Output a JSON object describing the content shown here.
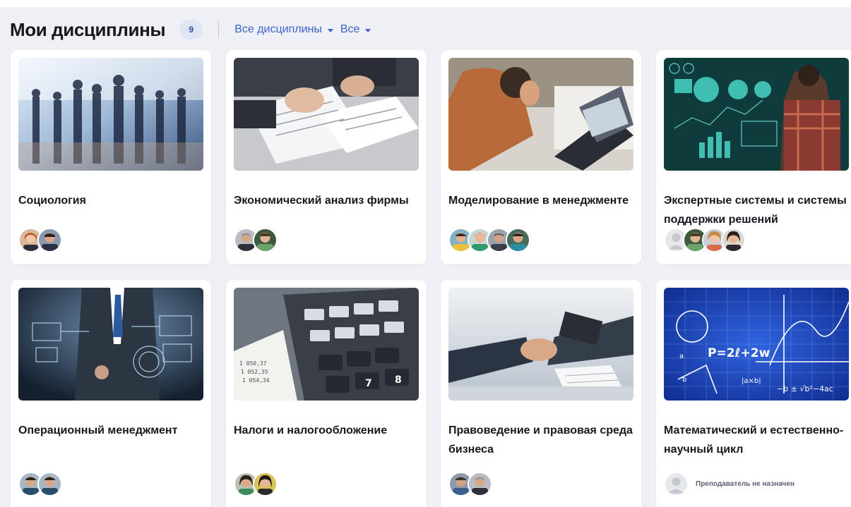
{
  "header": {
    "title": "Мои дисциплины",
    "count": "9",
    "filter_disciplines": "Все дисциплины",
    "filter_status": "Все"
  },
  "colors": {
    "accent": "#3c63c9",
    "badge_bg": "#dfe5f3",
    "page_bg": "#eef0f5"
  },
  "cards": [
    {
      "title": "Социология",
      "image": "business-people-crowd",
      "avatars": [
        "woman-red-hair",
        "man-dark-suit"
      ]
    },
    {
      "title": "Экономический анализ фирмы",
      "image": "signing-documents",
      "avatars": [
        "man-glasses-gray",
        "man-green-shirt"
      ]
    },
    {
      "title": "Моделирование в менеджменте",
      "image": "man-at-laptop",
      "avatars": [
        "man-yellow-shirt",
        "woman-green",
        "man-gray-suit",
        "man-teal-shirt"
      ]
    },
    {
      "title": "Экспертные системы и системы поддержки решений",
      "image": "data-charts-screen",
      "avatars": [
        "placeholder",
        "man-green-shirt",
        "woman-blonde",
        "woman-dark"
      ]
    },
    {
      "title": "Операционный менеджмент",
      "image": "virtual-interface",
      "avatars": [
        "man-young",
        "man-young-2"
      ]
    },
    {
      "title": "Налоги и налогообложение",
      "image": "calculator-keys",
      "avatars": [
        "woman-green-top",
        "woman-dark-hair"
      ]
    },
    {
      "title": "Правоведение и правовая среда бизнеса",
      "image": "handshake",
      "avatars": [
        "man-blue-shirt",
        "man-glasses-gray"
      ]
    },
    {
      "title": "Математический и естественно-научный цикл",
      "image": "math-formulas-blackboard",
      "avatars": [
        "placeholder"
      ],
      "no_teacher_label": "Преподаватель не назначен"
    }
  ]
}
